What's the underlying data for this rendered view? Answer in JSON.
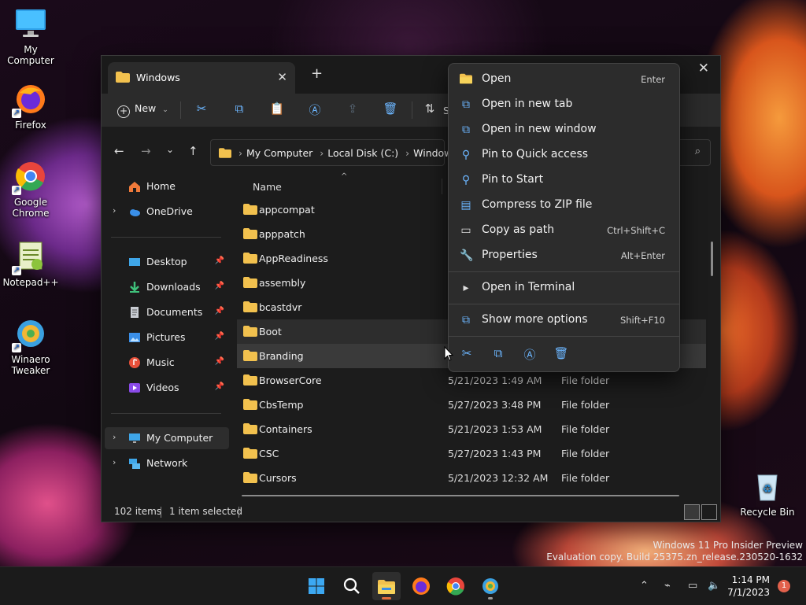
{
  "desktop": {
    "icons": [
      {
        "label": "My Computer"
      },
      {
        "label": "Firefox"
      },
      {
        "label": "Google Chrome"
      },
      {
        "label": "Notepad++"
      },
      {
        "label": "Winaero Tweaker"
      },
      {
        "label": "Recycle Bin"
      }
    ]
  },
  "window": {
    "tab_title": "Windows",
    "new_label": "New",
    "sort_partial": "S",
    "breadcrumb": [
      "My Computer",
      "Local Disk (C:)",
      "Windows"
    ]
  },
  "nav": {
    "home": "Home",
    "onedrive": "OneDrive",
    "desktop": "Desktop",
    "downloads": "Downloads",
    "documents": "Documents",
    "pictures": "Pictures",
    "music": "Music",
    "videos": "Videos",
    "my_computer": "My Computer",
    "network": "Network"
  },
  "columns": {
    "name": "Name"
  },
  "files": [
    {
      "name": "appcompat",
      "date": "",
      "type": ""
    },
    {
      "name": "apppatch",
      "date": "",
      "type": ""
    },
    {
      "name": "AppReadiness",
      "date": "",
      "type": ""
    },
    {
      "name": "assembly",
      "date": "",
      "type": ""
    },
    {
      "name": "bcastdvr",
      "date": "",
      "type": ""
    },
    {
      "name": "Boot",
      "date": "",
      "type": ""
    },
    {
      "name": "Branding",
      "date": "",
      "type": ""
    },
    {
      "name": "BrowserCore",
      "date": "5/21/2023 1:49 AM",
      "type": "File folder"
    },
    {
      "name": "CbsTemp",
      "date": "5/27/2023 3:48 PM",
      "type": "File folder"
    },
    {
      "name": "Containers",
      "date": "5/21/2023 1:53 AM",
      "type": "File folder"
    },
    {
      "name": "CSC",
      "date": "5/27/2023 1:43 PM",
      "type": "File folder"
    },
    {
      "name": "Cursors",
      "date": "5/21/2023 12:32 AM",
      "type": "File folder"
    }
  ],
  "status": {
    "items": "102 items",
    "selected": "1 item selected"
  },
  "context_menu": {
    "items": [
      {
        "label": "Open",
        "shortcut": "Enter",
        "icon": "folder-open-icon"
      },
      {
        "label": "Open in new tab",
        "shortcut": "",
        "icon": "new-tab-icon"
      },
      {
        "label": "Open in new window",
        "shortcut": "",
        "icon": "new-window-icon"
      },
      {
        "label": "Pin to Quick access",
        "shortcut": "",
        "icon": "pin-icon"
      },
      {
        "label": "Pin to Start",
        "shortcut": "",
        "icon": "pin-start-icon"
      },
      {
        "label": "Compress to ZIP file",
        "shortcut": "",
        "icon": "zip-icon"
      },
      {
        "label": "Copy as path",
        "shortcut": "Ctrl+Shift+C",
        "icon": "copy-path-icon"
      },
      {
        "label": "Properties",
        "shortcut": "Alt+Enter",
        "icon": "wrench-icon"
      },
      {
        "label": "Open in Terminal",
        "shortcut": "",
        "icon": "terminal-icon"
      },
      {
        "label": "Show more options",
        "shortcut": "Shift+F10",
        "icon": "more-options-icon"
      }
    ]
  },
  "taskbar": {
    "time": "1:14 PM",
    "date": "7/1/2023",
    "notifications": "1"
  },
  "watermark": {
    "line1": "Windows 11 Pro Insider Preview",
    "line2": "Evaluation copy. Build 25375.zn_release.230520-1632"
  },
  "colors": {
    "accent": "#6cb6ff",
    "folder": "#f2c14e",
    "badge": "#e2614c"
  }
}
